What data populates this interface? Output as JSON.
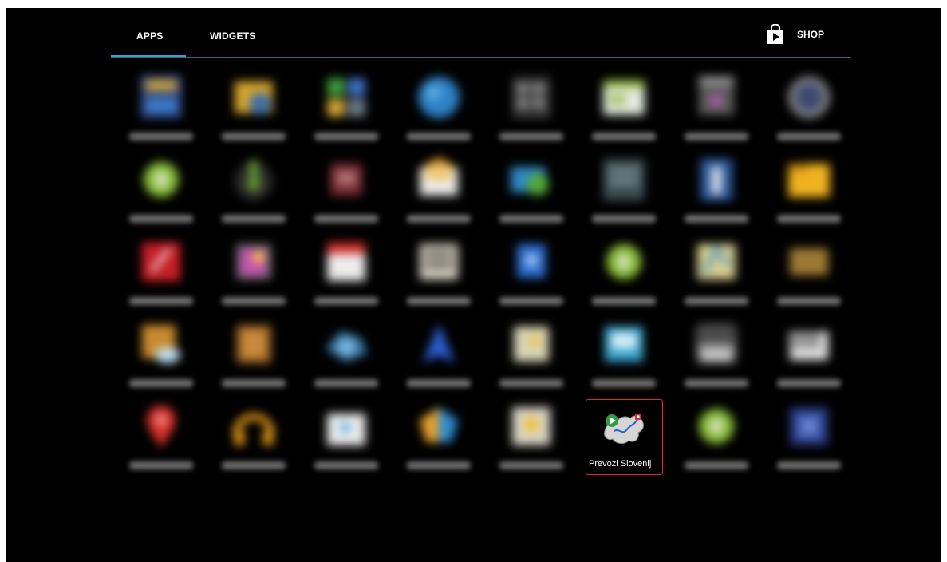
{
  "tabs": [
    {
      "label": "APPS",
      "selected": true
    },
    {
      "label": "WIDGETS",
      "selected": false
    }
  ],
  "shop": {
    "label": "SHOP",
    "icon": "play-store-bag-icon"
  },
  "colors": {
    "accent": "#33a4d6",
    "highlight": "#e0282b",
    "background": "#000000"
  },
  "highlighted_app": {
    "label": "Prevozi Slovenij",
    "icon": "slovenia-map-route-icon"
  },
  "app_rows": [
    [
      "app-icon",
      "app-icon",
      "app-icon",
      "app-icon",
      "app-icon",
      "app-icon",
      "app-icon",
      "app-icon"
    ],
    [
      "app-icon",
      "app-icon",
      "app-icon",
      "app-icon",
      "app-icon",
      "app-icon",
      "app-icon",
      "app-icon"
    ],
    [
      "app-icon",
      "app-icon",
      "app-icon",
      "app-icon",
      "app-icon",
      "app-icon",
      "app-icon",
      "app-icon"
    ],
    [
      "app-icon",
      "app-icon",
      "app-icon",
      "app-icon",
      "app-icon",
      "app-icon",
      "app-icon",
      "app-icon"
    ],
    [
      "app-icon",
      "app-icon",
      "app-icon",
      "app-icon",
      "app-icon",
      "highlighted",
      "app-icon",
      "app-icon"
    ]
  ]
}
